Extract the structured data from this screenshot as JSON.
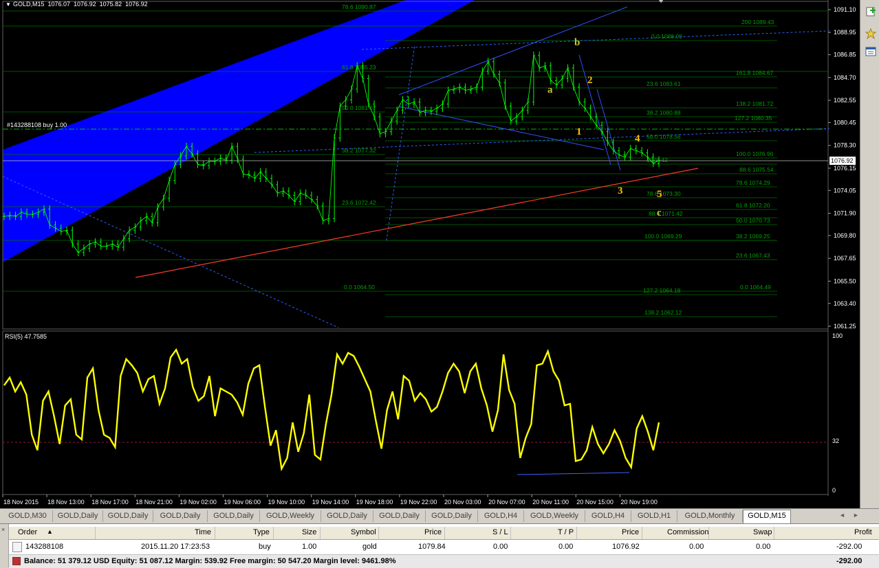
{
  "chart": {
    "header": "GOLD,M15  1076.07  1076.92  1075.82  1076.92",
    "trade_label": "#143288108 buy 1.00",
    "current_price": "1076.92",
    "price_axis": [
      "1091.10",
      "1088.95",
      "1086.85",
      "1084.70",
      "1082.55",
      "1080.45",
      "1078.30",
      "1076.15",
      "1074.05",
      "1071.90",
      "1069.80",
      "1067.65",
      "1065.50",
      "1063.40",
      "1061.25"
    ],
    "time_axis": [
      "18 Nov 2015",
      "18 Nov 13:00",
      "18 Nov 17:00",
      "18 Nov 21:00",
      "19 Nov 02:00",
      "19 Nov 06:00",
      "19 Nov 10:00",
      "19 Nov 14:00",
      "19 Nov 18:00",
      "19 Nov 22:00",
      "20 Nov 03:00",
      "20 Nov 07:00",
      "20 Nov 11:00",
      "20 Nov 15:00",
      "20 Nov 19:00"
    ],
    "fib_labels": [
      {
        "text": "78.6  1090.87"
      },
      {
        "text": "200  1089.43"
      },
      {
        "text": "0.0  1088.09"
      },
      {
        "text": "161.8  1084.67"
      },
      {
        "text": "61.8  1085.23"
      },
      {
        "text": "23.6  1083.61"
      },
      {
        "text": "138.2  1081.72"
      },
      {
        "text": "50.0  1081.67"
      },
      {
        "text": "38.2  1080.88"
      },
      {
        "text": "127.2  1080.35"
      },
      {
        "text": "50.0  1078.56"
      },
      {
        "text": "38.2  1077.32"
      },
      {
        "text": "100.0  1076.96"
      },
      {
        "text": "1076.42"
      },
      {
        "text": "88.6  1075.54"
      },
      {
        "text": "78.6  1074.29"
      },
      {
        "text": "78.6  1073.30"
      },
      {
        "text": "23.6  1072.42"
      },
      {
        "text": "61.8  1072.20"
      },
      {
        "text": "88.6  1071.42"
      },
      {
        "text": "50.0  1070.73"
      },
      {
        "text": "100.0  1069.29"
      },
      {
        "text": "38.2  1069.25"
      },
      {
        "text": "23.6  1067.43"
      },
      {
        "text": "0.0  1064.50"
      },
      {
        "text": "0.0  1064.49"
      },
      {
        "text": "127.2  1064.18"
      },
      {
        "text": "138.2  1062.12"
      }
    ],
    "wave_labels": [
      "a",
      "b",
      "c",
      "1",
      "2",
      "3",
      "4",
      "5"
    ],
    "rsi_header": "RSI(5) 47.7585",
    "rsi_axis": [
      "100",
      "32",
      "0"
    ],
    "price_series": [
      1071.6,
      1071.7,
      1071.6,
      1072.0,
      1071.8,
      1071.8,
      1072.0,
      1072.3,
      1070.8,
      1070.5,
      1070.2,
      1070.3,
      1069.0,
      1068.2,
      1068.6,
      1069.0,
      1069.2,
      1068.8,
      1068.8,
      1069.0,
      1068.7,
      1069.5,
      1070.3,
      1070.6,
      1071.2,
      1071.6,
      1071.0,
      1072.5,
      1073.3,
      1075.0,
      1076.5,
      1077.3,
      1078.2,
      1077.5,
      1076.5,
      1076.4,
      1076.8,
      1076.8,
      1077.1,
      1076.9,
      1078.2,
      1077.0,
      1075.6,
      1075.5,
      1075.2,
      1075.8,
      1075.2,
      1074.6,
      1073.8,
      1074.0,
      1073.6,
      1073.0,
      1073.8,
      1073.6,
      1073.2,
      1072.6,
      1071.2,
      1071.4,
      1079.0,
      1082.0,
      1082.6,
      1083.6,
      1085.8,
      1084.6,
      1082.2,
      1081.0,
      1079.4,
      1079.6,
      1080.6,
      1081.6,
      1082.6,
      1082.2,
      1082.4,
      1081.4,
      1081.6,
      1081.5,
      1081.8,
      1082.2,
      1083.5,
      1083.6,
      1083.8,
      1083.5,
      1083.6,
      1083.8,
      1085.3,
      1086.2,
      1085.0,
      1084.2,
      1082.0,
      1080.6,
      1081.0,
      1081.6,
      1082.4,
      1086.8,
      1085.6,
      1085.8,
      1084.4,
      1084.0,
      1084.6,
      1085.6,
      1083.8,
      1082.4,
      1081.8,
      1081.0,
      1080.2,
      1079.6,
      1078.6,
      1077.8,
      1077.4,
      1077.2,
      1078.0,
      1077.8,
      1077.6,
      1077.2,
      1076.6,
      1076.9
    ],
    "rsi_series": [
      68,
      73,
      64,
      70,
      62,
      36,
      26,
      58,
      64,
      48,
      30,
      55,
      59,
      36,
      33,
      73,
      79,
      52,
      36,
      34,
      28,
      74,
      85,
      81,
      76,
      64,
      72,
      74,
      56,
      66,
      86,
      91,
      82,
      85,
      67,
      58,
      61,
      74,
      48,
      66,
      64,
      62,
      57,
      49,
      69,
      79,
      81,
      54,
      29,
      39,
      14,
      21,
      44,
      25,
      37,
      62,
      23,
      20,
      43,
      62,
      88,
      82,
      89,
      87,
      80,
      72,
      64,
      45,
      27,
      52,
      64,
      46,
      74,
      71,
      58,
      63,
      59,
      51,
      54,
      64,
      76,
      82,
      77,
      63,
      77,
      82,
      66,
      55,
      38,
      52,
      88,
      65,
      56,
      21,
      34,
      43,
      81,
      82,
      90,
      77,
      71,
      55,
      56,
      19,
      20,
      26,
      41,
      30,
      24,
      30,
      39,
      32,
      21,
      15,
      40,
      48,
      38,
      26,
      44
    ]
  },
  "tabs": [
    "GOLD,M30",
    "GOLD,Daily",
    "GOLD,Daily",
    "GOLD,Daily",
    "GOLD,Daily",
    "GOLD,Weekly",
    "GOLD,Daily",
    "GOLD,Daily",
    "GOLD,Daily",
    "GOLD,H4",
    "GOLD,Weekly",
    "GOLD,H4",
    "GOLD,H1",
    "GOLD,Monthly",
    "GOLD,M15"
  ],
  "toolbar": {
    "icons": [
      "new-order-icon",
      "favorites-star-icon",
      "list-window-icon"
    ]
  },
  "terminal": {
    "headers": [
      "Order",
      "Time",
      "Type",
      "Size",
      "Symbol",
      "Price",
      "S / L",
      "T / P",
      "Price",
      "Commission",
      "Swap",
      "Profit"
    ],
    "order_row": [
      "143288108",
      "2015.11.20 17:23:53",
      "buy",
      "1.00",
      "gold",
      "1079.84",
      "0.00",
      "0.00",
      "1076.92",
      "0.00",
      "0.00",
      "-292.00"
    ],
    "balance_text": "Balance: 51 379.12 USD  Equity: 51 087.12  Margin: 539.92  Free margin: 50 547.20  Margin level: 9461.98%",
    "balance_profit": "-292.00"
  },
  "colors": {
    "background": "#000000",
    "candles": "#00ff00",
    "grid_fib": "#008000",
    "rsi": "#ffff00",
    "channel": "#0000ff",
    "trendline": "#ff3c28",
    "wave_label": "#ffc000"
  }
}
